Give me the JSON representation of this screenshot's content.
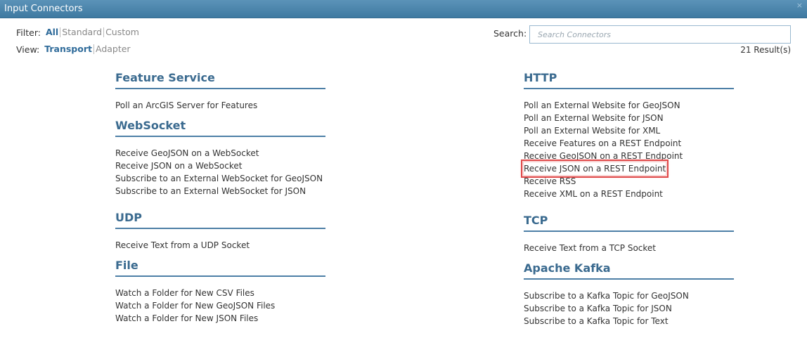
{
  "window": {
    "title": "Input Connectors",
    "close_glyph": "×"
  },
  "filter": {
    "label": "Filter:",
    "options": [
      "All",
      "Standard",
      "Custom"
    ],
    "selected": "All"
  },
  "view": {
    "label": "View:",
    "options": [
      "Transport",
      "Adapter"
    ],
    "selected": "Transport"
  },
  "search": {
    "label": "Search:",
    "placeholder": "Search Connectors",
    "value": ""
  },
  "result_count": "21 Result(s)",
  "columns": {
    "left": [
      {
        "title": "Feature Service",
        "items": [
          "Poll an ArcGIS Server for Features"
        ]
      },
      {
        "title": "WebSocket",
        "items": [
          "Receive GeoJSON on a WebSocket",
          "Receive JSON on a WebSocket",
          "Subscribe to an External WebSocket for GeoJSON",
          "Subscribe to an External WebSocket for JSON"
        ]
      },
      {
        "title": "UDP",
        "items": [
          "Receive Text from a UDP Socket"
        ]
      },
      {
        "title": "File",
        "items": [
          "Watch a Folder for New CSV Files",
          "Watch a Folder for New GeoJSON Files",
          "Watch a Folder for New JSON Files"
        ]
      }
    ],
    "right": [
      {
        "title": "HTTP",
        "items": [
          "Poll an External Website for GeoJSON",
          "Poll an External Website for JSON",
          "Poll an External Website for XML",
          "Receive Features on a REST Endpoint",
          "Receive GeoJSON on a REST Endpoint",
          "Receive JSON on a REST Endpoint",
          "Receive RSS",
          "Receive XML on a REST Endpoint"
        ]
      },
      {
        "title": "TCP",
        "items": [
          "Receive Text from a TCP Socket"
        ]
      },
      {
        "title": "Apache Kafka",
        "items": [
          "Subscribe to a Kafka Topic for GeoJSON",
          "Subscribe to a Kafka Topic for JSON",
          "Subscribe to a Kafka Topic for Text"
        ]
      }
    ]
  },
  "highlighted_item": "Receive JSON on a REST Endpoint",
  "colors": {
    "titlebar": "#4a86ad",
    "accent": "#2f6b9a",
    "highlight": "#e04848"
  }
}
